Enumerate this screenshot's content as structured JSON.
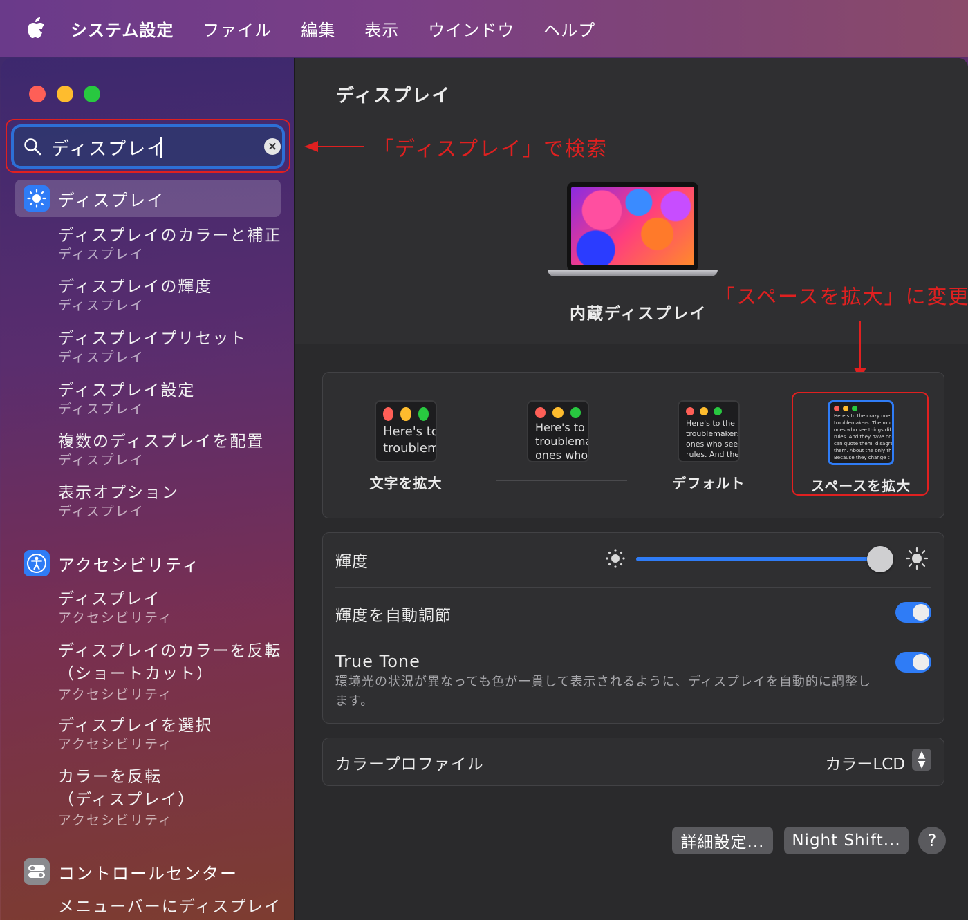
{
  "menubar": {
    "app_name": "システム設定",
    "items": [
      "ファイル",
      "編集",
      "表示",
      "ウインドウ",
      "ヘルプ"
    ]
  },
  "search": {
    "value": "ディスプレイ",
    "icon": "search-icon"
  },
  "sidebar": {
    "group1": {
      "header": "ディスプレイ",
      "icon_color": "#2f7cf6",
      "items": [
        {
          "title": "ディスプレイのカラーと補正",
          "sub": "ディスプレイ"
        },
        {
          "title": "ディスプレイの輝度",
          "sub": "ディスプレイ"
        },
        {
          "title": "ディスプレイプリセット",
          "sub": "ディスプレイ"
        },
        {
          "title": "ディスプレイ設定",
          "sub": "ディスプレイ"
        },
        {
          "title": "複数のディスプレイを配置",
          "sub": "ディスプレイ"
        },
        {
          "title": "表示オプション",
          "sub": "ディスプレイ"
        }
      ]
    },
    "group2": {
      "header": "アクセシビリティ",
      "icon_color": "#2f7cf6",
      "items": [
        {
          "title": "ディスプレイ",
          "sub": "アクセシビリティ"
        },
        {
          "title": "ディスプレイのカラーを反転",
          "title2": "（ショートカット）",
          "sub": "アクセシビリティ"
        },
        {
          "title": "ディスプレイを選択",
          "sub": "アクセシビリティ"
        },
        {
          "title": "カラーを反転",
          "title2": "（ディスプレイ）",
          "sub": "アクセシビリティ"
        }
      ]
    },
    "group3": {
      "header": "コントロールセンター",
      "items": [
        {
          "title": "メニューバーにディスプレイ"
        }
      ]
    }
  },
  "content": {
    "title": "ディスプレイ",
    "display_name": "内蔵ディスプレイ",
    "resolution_options": [
      {
        "label": "文字を拡大",
        "preview_text": [
          "Here's tc",
          "troublem"
        ]
      },
      {
        "label": "",
        "preview_text": [
          "Here's to t",
          "troublema",
          "ones who"
        ]
      },
      {
        "label": "デフォルト",
        "preview_text": [
          "Here's to the cr",
          "troublemakers.",
          "ones who see t",
          "rules. And they"
        ]
      },
      {
        "label": "スペースを拡大",
        "preview_text": [
          "Here's to the crazy one",
          "troublemakers. The rou",
          "ones who see things dif",
          "rules. And they have no",
          "can quote them, disagre",
          "them. About the only th",
          "Because they change t"
        ]
      }
    ],
    "selected_resolution": "スペースを拡大",
    "brightness_label": "輝度",
    "brightness_value": 0.98,
    "auto_brightness_label": "輝度を自動調節",
    "auto_brightness_on": true,
    "true_tone_label": "True Tone",
    "true_tone_desc": "環境光の状況が異なっても色が一貫して表示されるように、ディスプレイを自動的に調整します。",
    "true_tone_on": true,
    "color_profile_label": "カラープロファイル",
    "color_profile_value": "カラーLCD",
    "buttons": {
      "advanced": "詳細設定...",
      "night_shift": "Night Shift...",
      "help": "?"
    }
  },
  "annotations": {
    "search_note": "「ディスプレイ」で検索",
    "resolution_note": "「スペースを拡大」に変更",
    "color": "#e02020"
  }
}
